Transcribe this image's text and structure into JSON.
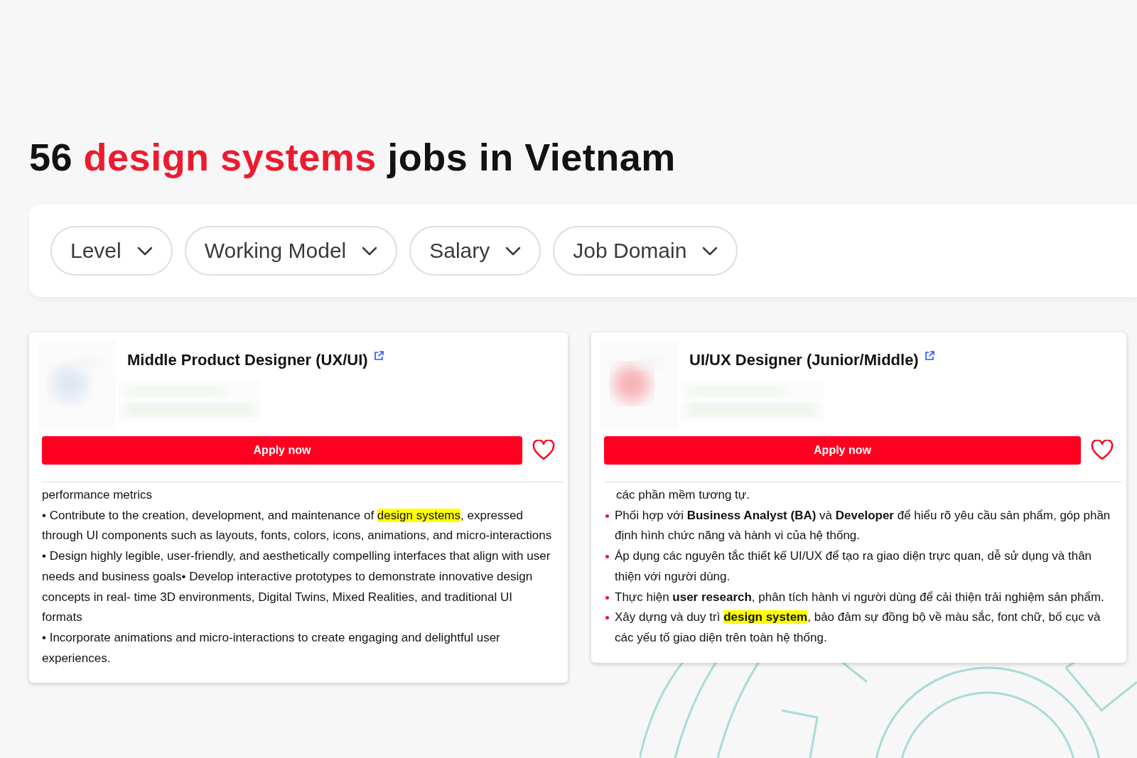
{
  "heading": [
    {
      "text": "56 ",
      "accent": false
    },
    {
      "text": "design systems",
      "accent": true
    },
    {
      "text": " jobs in Vietnam",
      "accent": false
    }
  ],
  "filters": [
    {
      "label": "Level"
    },
    {
      "label": "Working Model"
    },
    {
      "label": "Salary"
    },
    {
      "label": "Job Domain"
    }
  ],
  "jobs": [
    {
      "title": "Middle Product Designer (UX/UI)",
      "apply": "Apply now",
      "saved": false,
      "description": [
        {
          "kind": "plain",
          "segments": [
            {
              "text": "performance metrics",
              "highlight": false
            }
          ]
        },
        {
          "kind": "plain",
          "segments": [
            {
              "text": "• Contribute to the creation, development, and maintenance of ",
              "highlight": false
            },
            {
              "text": "design systems",
              "highlight": true
            },
            {
              "text": ", expressed through UI components such as layouts, fonts, colors, icons, animations, and micro-interactions",
              "highlight": false
            }
          ]
        },
        {
          "kind": "plain",
          "segments": [
            {
              "text": "• Design highly legible, user-friendly, and aesthetically compelling interfaces that align with user needs and business goals• Develop interactive prototypes to demonstrate innovative design concepts in real- time 3D environments, Digital Twins, Mixed Realities, and traditional UI formats",
              "highlight": false
            }
          ]
        },
        {
          "kind": "plain",
          "segments": [
            {
              "text": "• Incorporate animations and micro-interactions to create engaging and delightful user experiences.",
              "highlight": false
            }
          ]
        }
      ]
    },
    {
      "title": "UI/UX Designer (Junior/Middle)",
      "apply": "Apply now",
      "saved": false,
      "description": [
        {
          "kind": "plain",
          "segments": [
            {
              "text": "các phần mềm tương tự.",
              "highlight": false
            }
          ]
        },
        {
          "kind": "bullet",
          "segments": [
            {
              "text": "Phối hợp với **Business Analyst (BA)** và **Developer** để hiểu rõ yêu cầu sản phẩm, góp phần định hình chức năng và hành vi của hệ thống.",
              "highlight": false
            }
          ]
        },
        {
          "kind": "bullet",
          "segments": [
            {
              "text": "Áp dụng các nguyên tắc thiết kế UI/UX để tạo ra giao diện trực quan, dễ sử dụng và thân thiện với người dùng.",
              "highlight": false
            }
          ]
        },
        {
          "kind": "bullet",
          "segments": [
            {
              "text": "Thực hiện **user research**, phân tích hành vi người dùng để cải thiện trải nghiệm sản phẩm.",
              "highlight": false
            }
          ]
        },
        {
          "kind": "bullet",
          "segments": [
            {
              "text": "Xây dựng và duy trì ",
              "highlight": false
            },
            {
              "text": "**design system**",
              "highlight": true
            },
            {
              "text": ", bảo đảm sự đồng bộ về màu sắc, font chữ, bố cục và các yếu tố giao diện trên toàn hệ thống.",
              "highlight": false
            }
          ]
        }
      ]
    }
  ]
}
